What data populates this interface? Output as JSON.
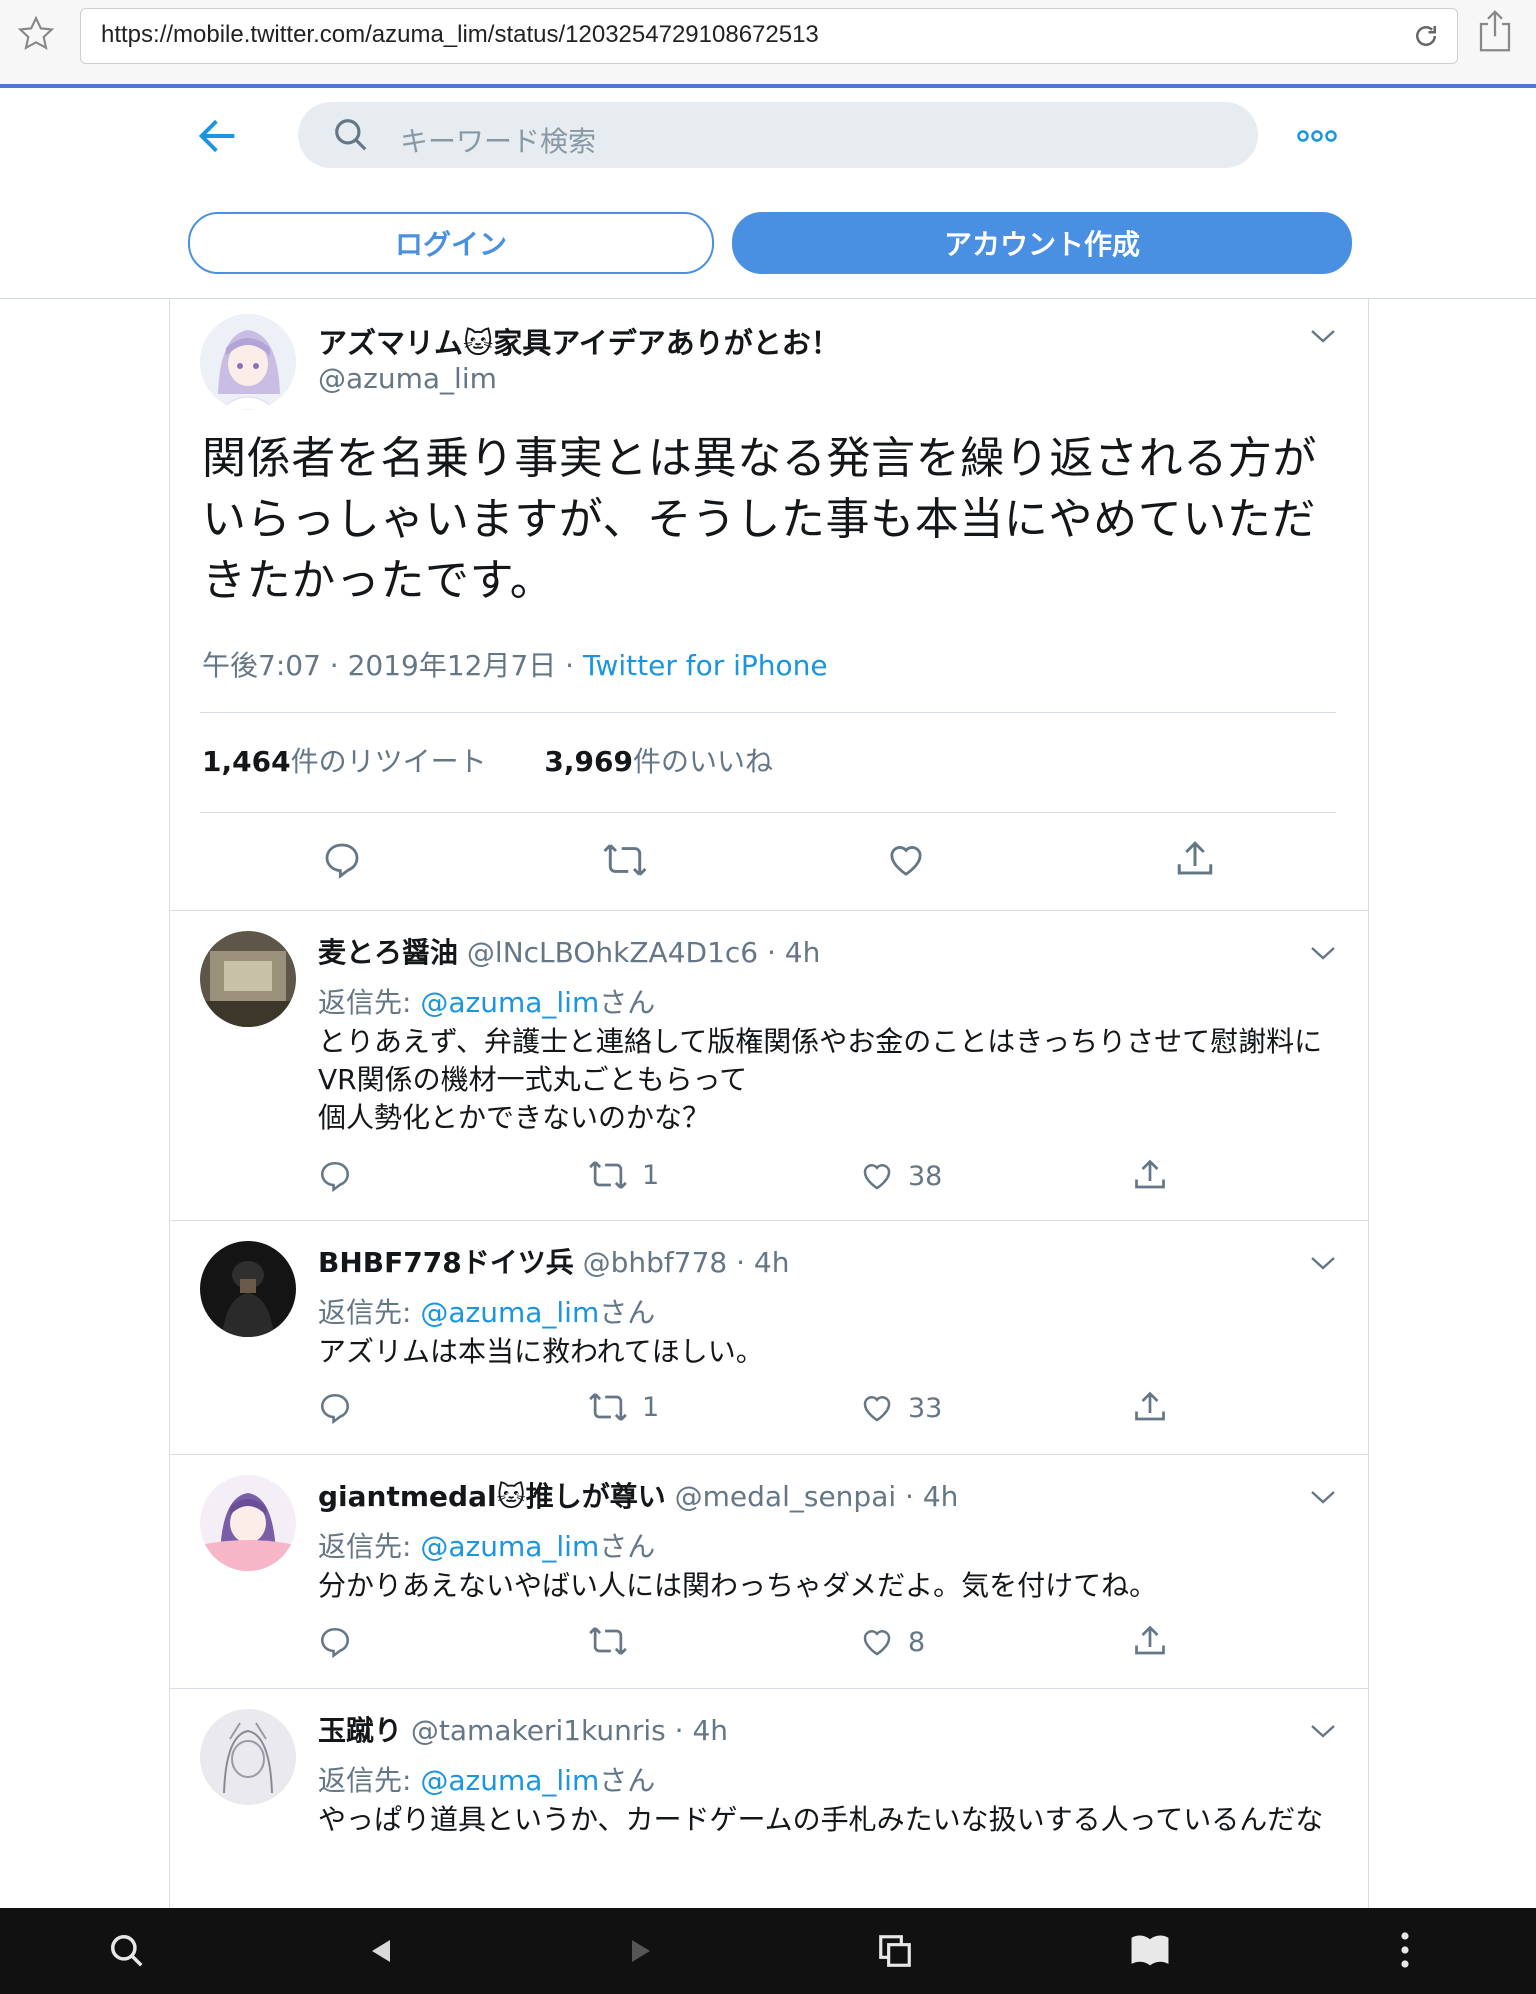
{
  "browser": {
    "url": "https://mobile.twitter.com/azuma_lim/status/1203254729108672513",
    "icons": [
      "star-icon",
      "reload-icon",
      "share-icon"
    ]
  },
  "header": {
    "search_placeholder": "キーワード検索",
    "login_label": "ログイン",
    "signup_label": "アカウント作成",
    "accent": "#4a90e2"
  },
  "tweet": {
    "author_name": "アズマリム🐱家具アイデアありがとお！",
    "author_handle": "@azuma_lim",
    "text": "関係者を名乗り事実とは異なる発言を繰り返される方がいらっしゃいますが、そうした事も本当にやめていただきたかったです。",
    "time": "午後7:07 · 2019年12月7日 · ",
    "source": "Twitter for iPhone",
    "retweet_count": "1,464",
    "retweet_label": "件のリツイート",
    "like_count": "3,969",
    "like_label": "件のいいね"
  },
  "replies": [
    {
      "name": "麦とろ醤油",
      "handle": "@lNcLBOhkZA4D1c6",
      "time": " · 4h",
      "to_prefix": "返信先: ",
      "to_handle": "@azuma_lim",
      "to_suffix": "さん",
      "text": "とりあえず、弁護士と連絡して版権関係やお金のことはきっちりさせて慰謝料にVR関係の機材一式丸ごともらって\n個人勢化とかできないのかな？",
      "retweets": "1",
      "likes": "38"
    },
    {
      "name": "BHBF778ドイツ兵",
      "handle": "@bhbf778",
      "time": " · 4h",
      "to_prefix": "返信先: ",
      "to_handle": "@azuma_lim",
      "to_suffix": "さん",
      "text": "アズリムは本当に救われてほしい。",
      "retweets": "1",
      "likes": "33"
    },
    {
      "name": "giantmedal🐱推しが尊い",
      "handle": "@medal_senpai",
      "time": " · 4h",
      "to_prefix": "返信先: ",
      "to_handle": "@azuma_lim",
      "to_suffix": "さん",
      "text": "分かりあえないやばい人には関わっちゃダメだよ。気を付けてね。",
      "retweets": "",
      "likes": "8"
    },
    {
      "name": "玉蹴り",
      "handle": "@tamakeri1kunris",
      "time": " · 4h",
      "to_prefix": "返信先: ",
      "to_handle": "@azuma_lim",
      "to_suffix": "さん",
      "text": "やっぱり道具というか、カードゲームの手札みたいな扱いする人っているんだな",
      "retweets": "",
      "likes": ""
    }
  ],
  "bottom_bar": {
    "icons": [
      "search-icon",
      "back-icon",
      "forward-icon",
      "tabs-icon",
      "bookmarks-icon",
      "more-icon"
    ]
  }
}
